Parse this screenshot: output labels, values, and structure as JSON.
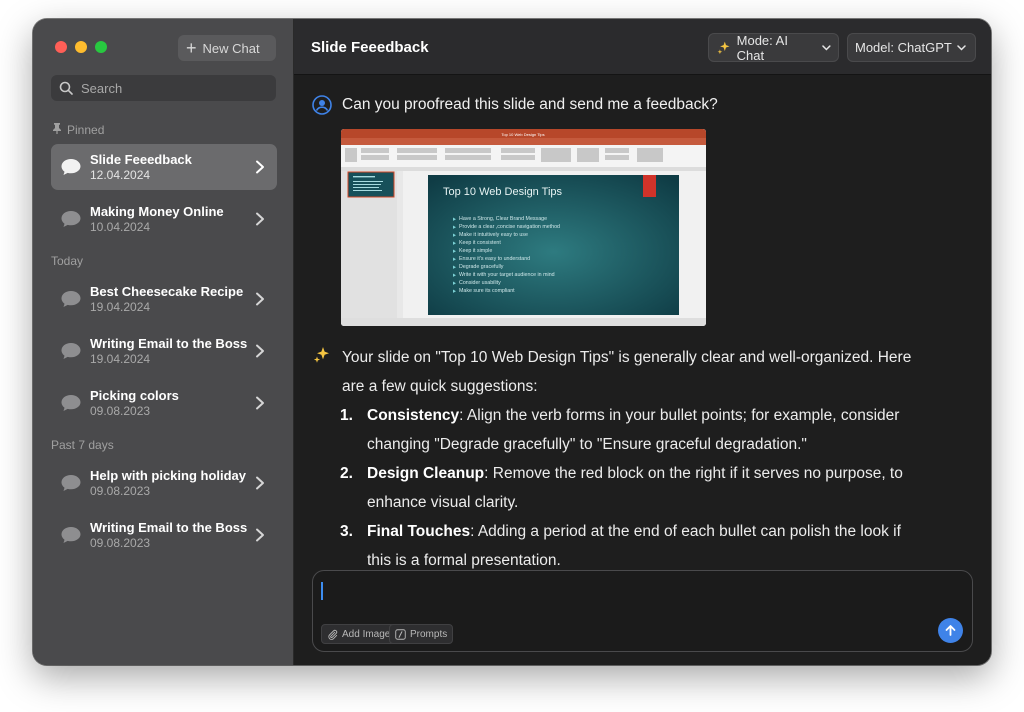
{
  "sidebar": {
    "new_chat_label": "New Chat",
    "search_placeholder": "Search",
    "sections": {
      "pinned": "Pinned",
      "today": "Today",
      "past7": "Past 7 days"
    },
    "items": [
      {
        "title": "Slide Feeedback",
        "date": "12.04.2024"
      },
      {
        "title": "Making Money Online",
        "date": "10.04.2024"
      },
      {
        "title": "Best Cheesecake Recipe",
        "date": "19.04.2024"
      },
      {
        "title": "Writing Email to the Boss",
        "date": "19.04.2024"
      },
      {
        "title": "Picking colors",
        "date": "09.08.2023"
      },
      {
        "title": "Help with picking holiday",
        "date": "09.08.2023"
      },
      {
        "title": "Writing Email to the Boss",
        "date": "09.08.2023"
      }
    ]
  },
  "header": {
    "title": "Slide Feeedback",
    "mode_label": "Mode: AI Chat",
    "model_label": "Model: ChatGPT"
  },
  "conversation": {
    "user_message": "Can you proofread this slide and send me a feedback?",
    "ai_intro": "Your slide on \"Top 10 Web Design Tips\" is generally clear and well-organized. Here are a few quick suggestions:",
    "ai_points": [
      {
        "num": "1.",
        "heading": "Consistency",
        "text": ": Align the verb forms in your bullet points; for example, consider changing \"Degrade gracefully\" to \"Ensure graceful degradation.\""
      },
      {
        "num": "2.",
        "heading": "Design Cleanup",
        "text": ": Remove the red block on the right if it serves no purpose, to enhance visual clarity."
      },
      {
        "num": "3.",
        "heading": "Final Touches",
        "text": ": Adding a period at the end of each bullet can polish the look if this is a formal presentation."
      }
    ]
  },
  "attachment": {
    "app_title": "Top 10 Web Design Tips",
    "slide_title": "Top 10 Web Design Tips",
    "bullets": [
      "Have a Strong, Clear Brand Message",
      "Provide a clear ,concise navigation method",
      "Make it intuitively easy to use",
      "Keep it consistent",
      "Keep it simple",
      "Ensure it's easy to understand",
      "Degrade gracefully",
      "Write it with your target audience in mind",
      "Consider usability",
      "Make sure its compliant"
    ]
  },
  "composer": {
    "add_image_label": "Add Image",
    "prompts_label": "Prompts"
  },
  "colors": {
    "accent": "#3f83e8",
    "sidebar_bg": "#4a4a4c",
    "main_bg": "#1e1e1e"
  }
}
